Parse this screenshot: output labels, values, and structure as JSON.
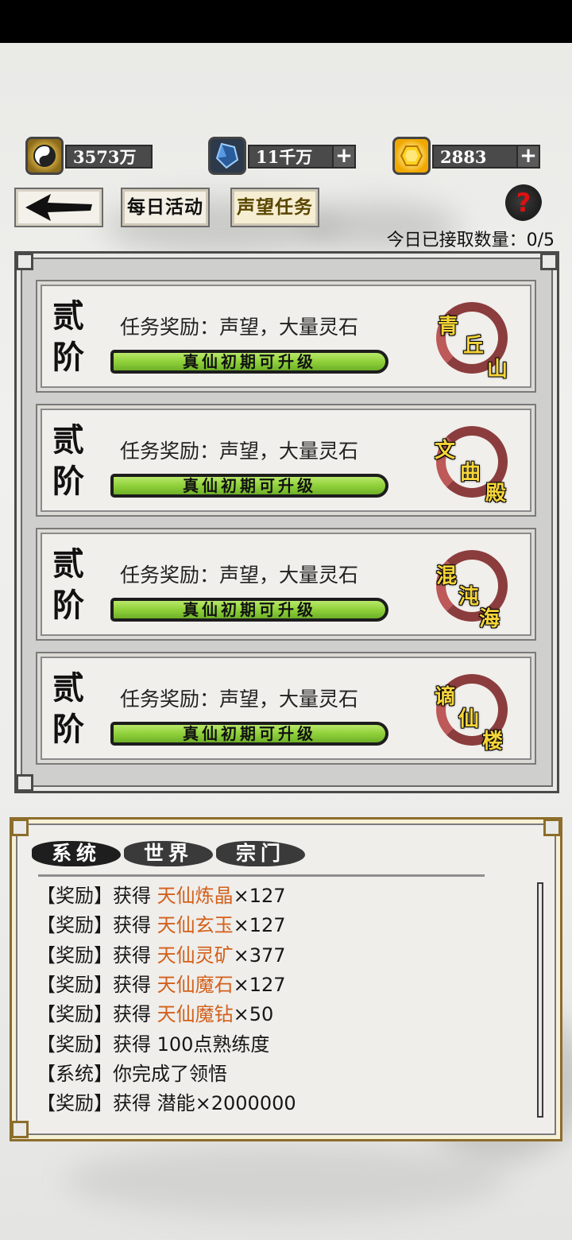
{
  "resources": [
    {
      "icon": "taiji-coin-icon",
      "value": "3573万",
      "has_plus": false
    },
    {
      "icon": "spirit-crystal-icon",
      "value": "11千万",
      "has_plus": true
    },
    {
      "icon": "gold-gem-icon",
      "value": "2883",
      "has_plus": true
    }
  ],
  "nav": {
    "back_icon": "arrow-left-icon",
    "tab_daily": "每日活动",
    "tab_reputation": "声望任务",
    "help_label": "?",
    "accepted_count": "今日已接取数量：0/5"
  },
  "quests": [
    {
      "rank_line1": "贰",
      "rank_line2": "阶",
      "reward": "任务奖励：声望，大量灵石",
      "bar_text": "真仙初期可升级",
      "seal": [
        "青",
        "丘",
        "山"
      ]
    },
    {
      "rank_line1": "贰",
      "rank_line2": "阶",
      "reward": "任务奖励：声望，大量灵石",
      "bar_text": "真仙初期可升级",
      "seal": [
        "文",
        "曲",
        "殿"
      ]
    },
    {
      "rank_line1": "贰",
      "rank_line2": "阶",
      "reward": "任务奖励：声望，大量灵石",
      "bar_text": "真仙初期可升级",
      "seal": [
        "混",
        "沌",
        "海"
      ]
    },
    {
      "rank_line1": "贰",
      "rank_line2": "阶",
      "reward": "任务奖励：声望，大量灵石",
      "bar_text": "真仙初期可升级",
      "seal": [
        "谪",
        "仙",
        "楼"
      ]
    }
  ],
  "log_tabs": [
    "系统",
    "世界",
    "宗门"
  ],
  "log_entries": [
    {
      "prefix": "【奖励】获得 ",
      "item": "天仙炼晶",
      "suffix": "×127"
    },
    {
      "prefix": "【奖励】获得 ",
      "item": "天仙玄玉",
      "suffix": "×127"
    },
    {
      "prefix": "【奖励】获得 ",
      "item": "天仙灵矿",
      "suffix": "×377"
    },
    {
      "prefix": "【奖励】获得 ",
      "item": "天仙魔石",
      "suffix": "×127"
    },
    {
      "prefix": "【奖励】获得 ",
      "item": "天仙魔钻",
      "suffix": "×50"
    },
    {
      "prefix": "【奖励】获得 100点熟练度",
      "item": "",
      "suffix": ""
    },
    {
      "prefix": "【系统】你完成了领悟",
      "item": "",
      "suffix": ""
    },
    {
      "prefix": "【奖励】获得 潜能×2000000",
      "item": "",
      "suffix": ""
    }
  ],
  "colors": {
    "highlight": "#d3601b",
    "bar_green": "#8fd13a",
    "seal_red": "#7a1f1f"
  }
}
